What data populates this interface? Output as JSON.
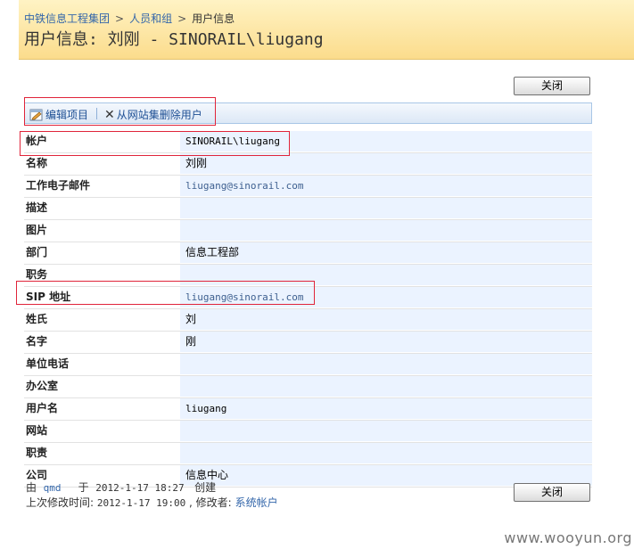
{
  "breadcrumb": {
    "site": "中铁信息工程集团",
    "people": "人员和组",
    "current": "用户信息",
    "separator": ">"
  },
  "page_title": "用户信息: 刘刚 - SINORAIL\\liugang",
  "buttons": {
    "close": "关闭"
  },
  "toolbar": {
    "edit": "编辑项目",
    "remove": "从网站集删除用户"
  },
  "fields": [
    {
      "label": "帐户",
      "value": "SINORAIL\\liugang"
    },
    {
      "label": "名称",
      "value": "刘刚"
    },
    {
      "label": "工作电子邮件",
      "value": "liugang@sinorail.com"
    },
    {
      "label": "描述",
      "value": ""
    },
    {
      "label": "图片",
      "value": ""
    },
    {
      "label": "部门",
      "value": "信息工程部"
    },
    {
      "label": "职务",
      "value": ""
    },
    {
      "label": "SIP 地址",
      "value": "liugang@sinorail.com"
    },
    {
      "label": "姓氏",
      "value": "刘"
    },
    {
      "label": "名字",
      "value": "刚"
    },
    {
      "label": "单位电话",
      "value": ""
    },
    {
      "label": "办公室",
      "value": ""
    },
    {
      "label": "用户名",
      "value": "liugang"
    },
    {
      "label": "网站",
      "value": ""
    },
    {
      "label": "职责",
      "value": ""
    },
    {
      "label": "公司",
      "value": "信息中心"
    }
  ],
  "footer": {
    "created_prefix": "由",
    "created_by": "qmd",
    "created_at_prefix": "于",
    "created_at": "2012-1-17 18:27",
    "created_suffix": "创建",
    "modified_prefix": "上次修改时间:",
    "modified_at": "2012-1-17 19:00",
    "modified_by_prefix": ", 修改者:",
    "modified_by": "系统帐户"
  },
  "watermark": "www.wooyun.org",
  "colors": {
    "header_bg": "#fbdc8c",
    "link": "#3366aa",
    "value_bg": "#ebf3ff",
    "highlight_box": "#e0243a"
  }
}
